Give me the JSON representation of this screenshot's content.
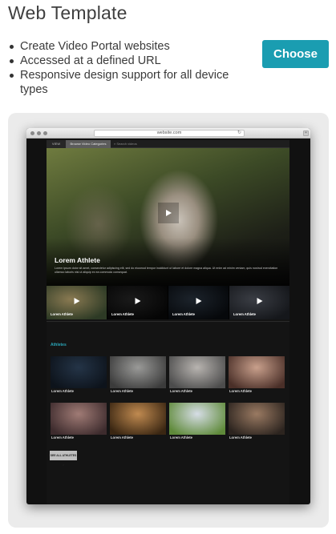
{
  "header": {
    "title": "Web Template"
  },
  "features": [
    "Create Video Portal websites",
    "Accessed at a defined URL",
    "Responsive design support for all device types"
  ],
  "actions": {
    "choose_label": "Choose"
  },
  "browser": {
    "url": "website.com"
  },
  "site": {
    "nav": {
      "home_label": "VIEW",
      "category_label": "Browse Video Categories",
      "search_placeholder": "Search videos"
    },
    "hero": {
      "title": "Lorem Athlete",
      "description": "Lorem ipsum dolor sit amet, consectetur adipiscing elit, sed do eiusmod tempor incididunt ut labore et dolore magna aliqua. Ut enim ad minim veniam, quis nostrud exercitation ullamco laboris nisi ut aliquip ex ea commodo consequat."
    },
    "strip": [
      {
        "label": "Lorem Athlete",
        "color_a": "#8a7a52",
        "color_b": "#2d3a25"
      },
      {
        "label": "Lorem Athlete",
        "color_a": "#1a1a1a",
        "color_b": "#050505"
      },
      {
        "label": "Lorem Athlete",
        "color_a": "#1c232b",
        "color_b": "#06080b"
      },
      {
        "label": "Lorem Athlete",
        "color_a": "#3a3d44",
        "color_b": "#15171b"
      }
    ],
    "section_title": "Athletes",
    "grid": [
      {
        "label": "Lorem Athlete",
        "color_a": "#243447",
        "color_b": "#0d131b"
      },
      {
        "label": "Lorem Athlete",
        "color_a": "#9a9a98",
        "color_b": "#3b3b3b"
      },
      {
        "label": "Lorem Athlete",
        "color_a": "#b8b4b0",
        "color_b": "#4c4c4c"
      },
      {
        "label": "Lorem Athlete",
        "color_a": "#c9a08c",
        "color_b": "#4a2f28"
      },
      {
        "label": "Lorem Athlete",
        "color_a": "#a07b75",
        "color_b": "#3d2b2d"
      },
      {
        "label": "Lorem Athlete",
        "color_a": "#c08a50",
        "color_b": "#3a2612"
      },
      {
        "label": "Lorem Athlete",
        "color_a": "#d6dde6",
        "color_b": "#5f8a3a"
      },
      {
        "label": "Lorem Athlete",
        "color_a": "#9a7a62",
        "color_b": "#2c241f"
      }
    ],
    "see_all_label": "SEE ALL ATHLETES >"
  }
}
